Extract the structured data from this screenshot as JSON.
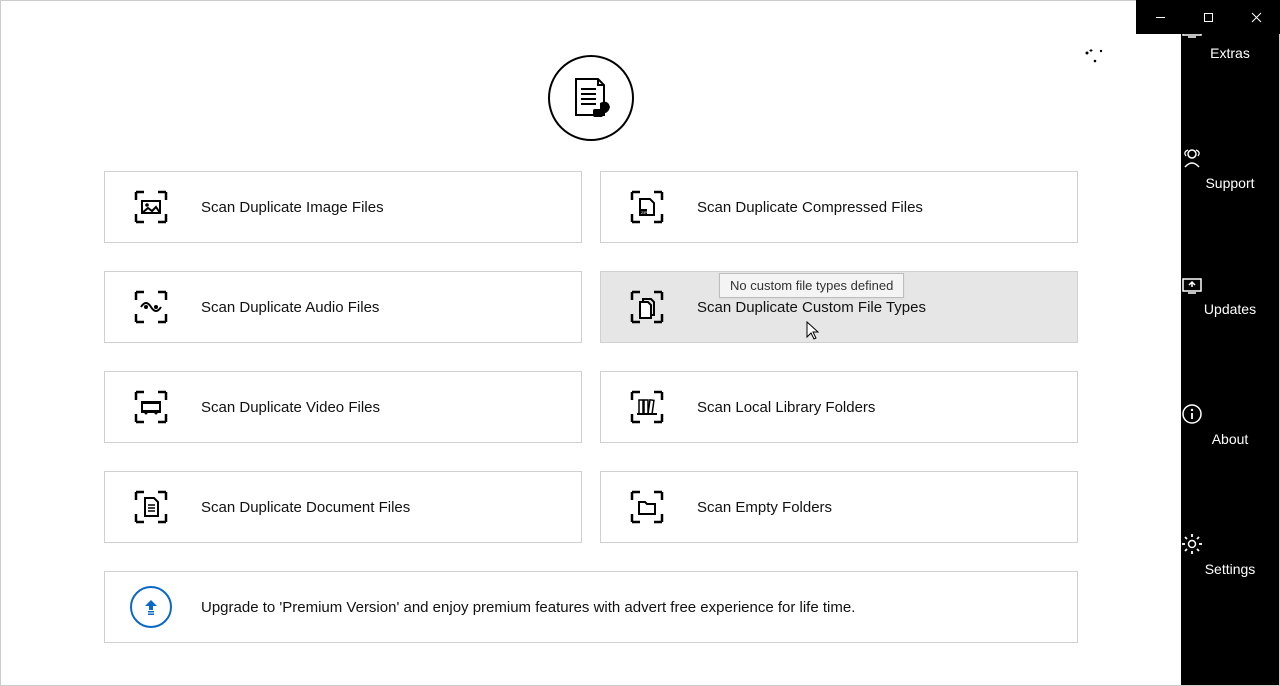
{
  "sidebar": {
    "items": [
      {
        "label": "Extras"
      },
      {
        "label": "Support"
      },
      {
        "label": "Updates"
      },
      {
        "label": "About"
      },
      {
        "label": "Settings"
      }
    ]
  },
  "cards": {
    "image": "Scan Duplicate Image Files",
    "audio": "Scan Duplicate Audio Files",
    "video": "Scan Duplicate Video Files",
    "document": "Scan Duplicate Document Files",
    "compressed": "Scan Duplicate Compressed Files",
    "custom": "Scan Duplicate Custom File Types",
    "library": "Scan Local Library Folders",
    "empty": "Scan Empty Folders"
  },
  "upgrade": {
    "text": "Upgrade to 'Premium Version' and enjoy premium features with advert free experience for life time."
  },
  "tooltip": {
    "text": "No custom file types defined"
  }
}
